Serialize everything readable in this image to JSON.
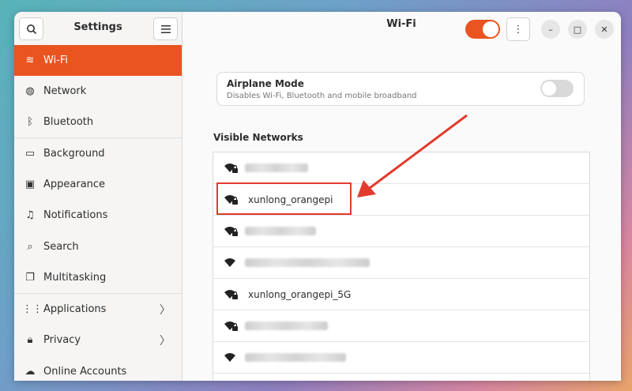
{
  "sidebar": {
    "title": "Settings",
    "items": [
      {
        "label": "Wi-Fi",
        "icon": "wifi-icon",
        "glyph": "≋",
        "active": true
      },
      {
        "label": "Network",
        "icon": "globe-icon",
        "glyph": "◍"
      },
      {
        "label": "Bluetooth",
        "icon": "bluetooth-icon",
        "glyph": "ᛒ"
      },
      {
        "label": "Background",
        "icon": "monitor-icon",
        "glyph": "▭"
      },
      {
        "label": "Appearance",
        "icon": "appearance-icon",
        "glyph": "▣"
      },
      {
        "label": "Notifications",
        "icon": "bell-icon",
        "glyph": "♫"
      },
      {
        "label": "Search",
        "icon": "search-icon",
        "glyph": "⌕"
      },
      {
        "label": "Multitasking",
        "icon": "multitasking-icon",
        "glyph": "❐"
      },
      {
        "label": "Applications",
        "icon": "grid-icon",
        "glyph": "⋮⋮",
        "chevron": "〉"
      },
      {
        "label": "Privacy",
        "icon": "lock-icon",
        "glyph": "🔒︎",
        "chevron": "〉"
      },
      {
        "label": "Online Accounts",
        "icon": "cloud-icon",
        "glyph": "☁"
      }
    ]
  },
  "header": {
    "title": "Wi-Fi",
    "wifi_enabled": true,
    "menu_glyph": "⋮",
    "minimize_glyph": "–",
    "maximize_glyph": "□",
    "close_glyph": "✕"
  },
  "airplane": {
    "title": "Airplane Mode",
    "subtitle": "Disables Wi-Fi, Bluetooth and mobile broadband",
    "enabled": false
  },
  "networks": {
    "label": "Visible Networks",
    "items": [
      {
        "ssid": "",
        "secured": true,
        "redacted": true
      },
      {
        "ssid": "xunlong_orangepi",
        "secured": true,
        "redacted": false,
        "highlighted": true
      },
      {
        "ssid": "",
        "secured": true,
        "redacted": true
      },
      {
        "ssid": "",
        "secured": false,
        "redacted": true
      },
      {
        "ssid": "xunlong_orangepi_5G",
        "secured": true,
        "redacted": false
      },
      {
        "ssid": "",
        "secured": true,
        "redacted": true
      },
      {
        "ssid": "",
        "secured": false,
        "redacted": true
      }
    ]
  },
  "colors": {
    "accent": "#e95420",
    "annotation": "#e23b2e"
  }
}
